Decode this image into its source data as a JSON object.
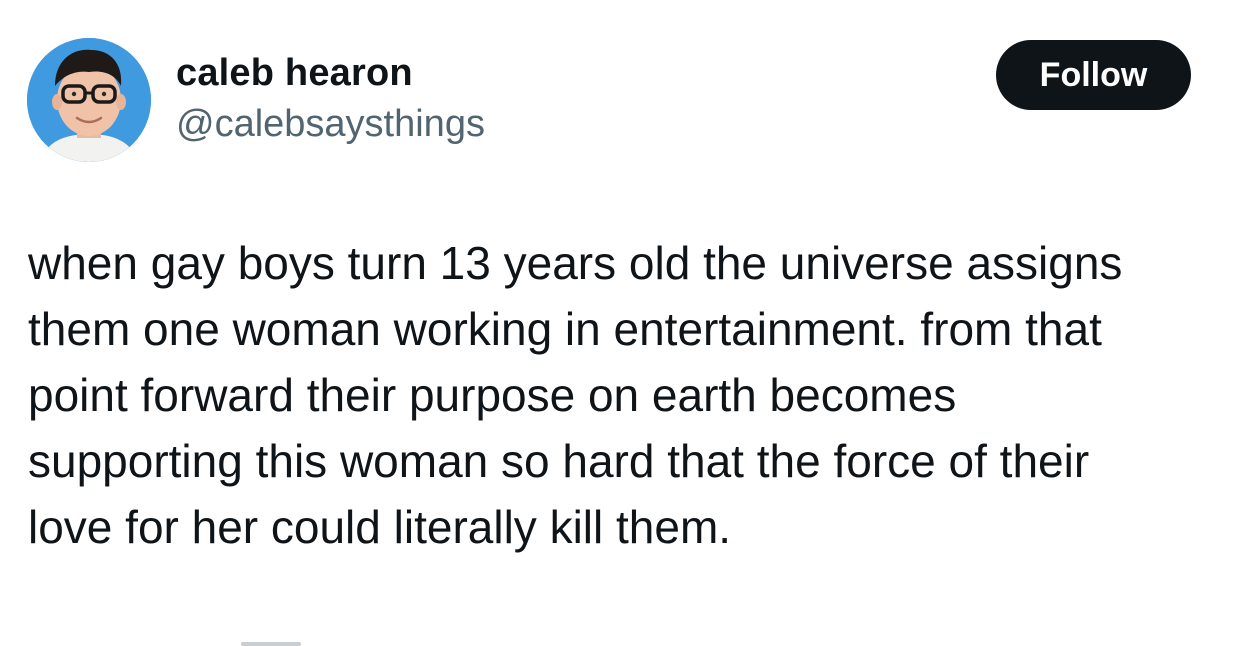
{
  "author": {
    "display_name": "caleb hearon",
    "handle": "@calebsaysthings",
    "avatar_icon": "profile-photo-avatar"
  },
  "actions": {
    "follow_label": "Follow"
  },
  "tweet": {
    "lines": [
      "when gay boys turn 13 years old the universe assigns",
      "them one woman working in entertainment. from that",
      "point forward their purpose on earth becomes",
      "supporting this woman so hard that the force of their",
      "love for her could literally kill them."
    ]
  },
  "colors": {
    "text_primary": "#0f1419",
    "text_secondary": "#536471",
    "button_bg": "#0f1419",
    "button_text": "#ffffff",
    "avatar_bg": "#3f9ae0"
  }
}
